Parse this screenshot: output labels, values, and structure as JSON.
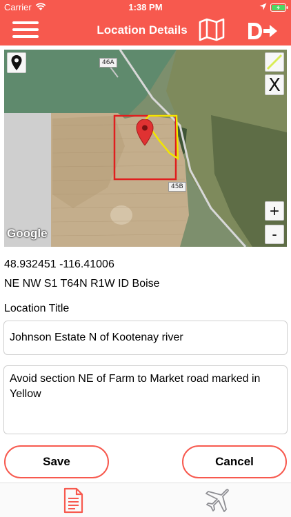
{
  "status_bar": {
    "carrier": "Carrier",
    "time": "1:38 PM"
  },
  "nav": {
    "title": "Location Details",
    "menu_icon": "hamburger-menu-icon",
    "map_icon": "folded-map-icon",
    "route_icon": "destination-arrow-icon",
    "bar_color": "#f7594e"
  },
  "map": {
    "road_labels": [
      "46A",
      "45B"
    ],
    "logo_text": "Google",
    "close_label": "X",
    "zoom_in_label": "+",
    "zoom_out_label": "-",
    "boundary_color": "#e01e1e",
    "highlight_color": "#f2e600"
  },
  "location": {
    "coordinates": "48.932451 -116.41006",
    "legal_description": "NE NW S1 T64N R1W ID Boise"
  },
  "form": {
    "title_label": "Location Title",
    "title_value": "Johnson Estate N of Kootenay river",
    "notes_value": "Avoid section NE of Farm to Market road marked in Yellow"
  },
  "actions": {
    "save_label": "Save",
    "cancel_label": "Cancel"
  },
  "tabs": [
    {
      "icon": "document-icon",
      "active": true
    },
    {
      "icon": "airplane-icon",
      "active": false
    }
  ]
}
